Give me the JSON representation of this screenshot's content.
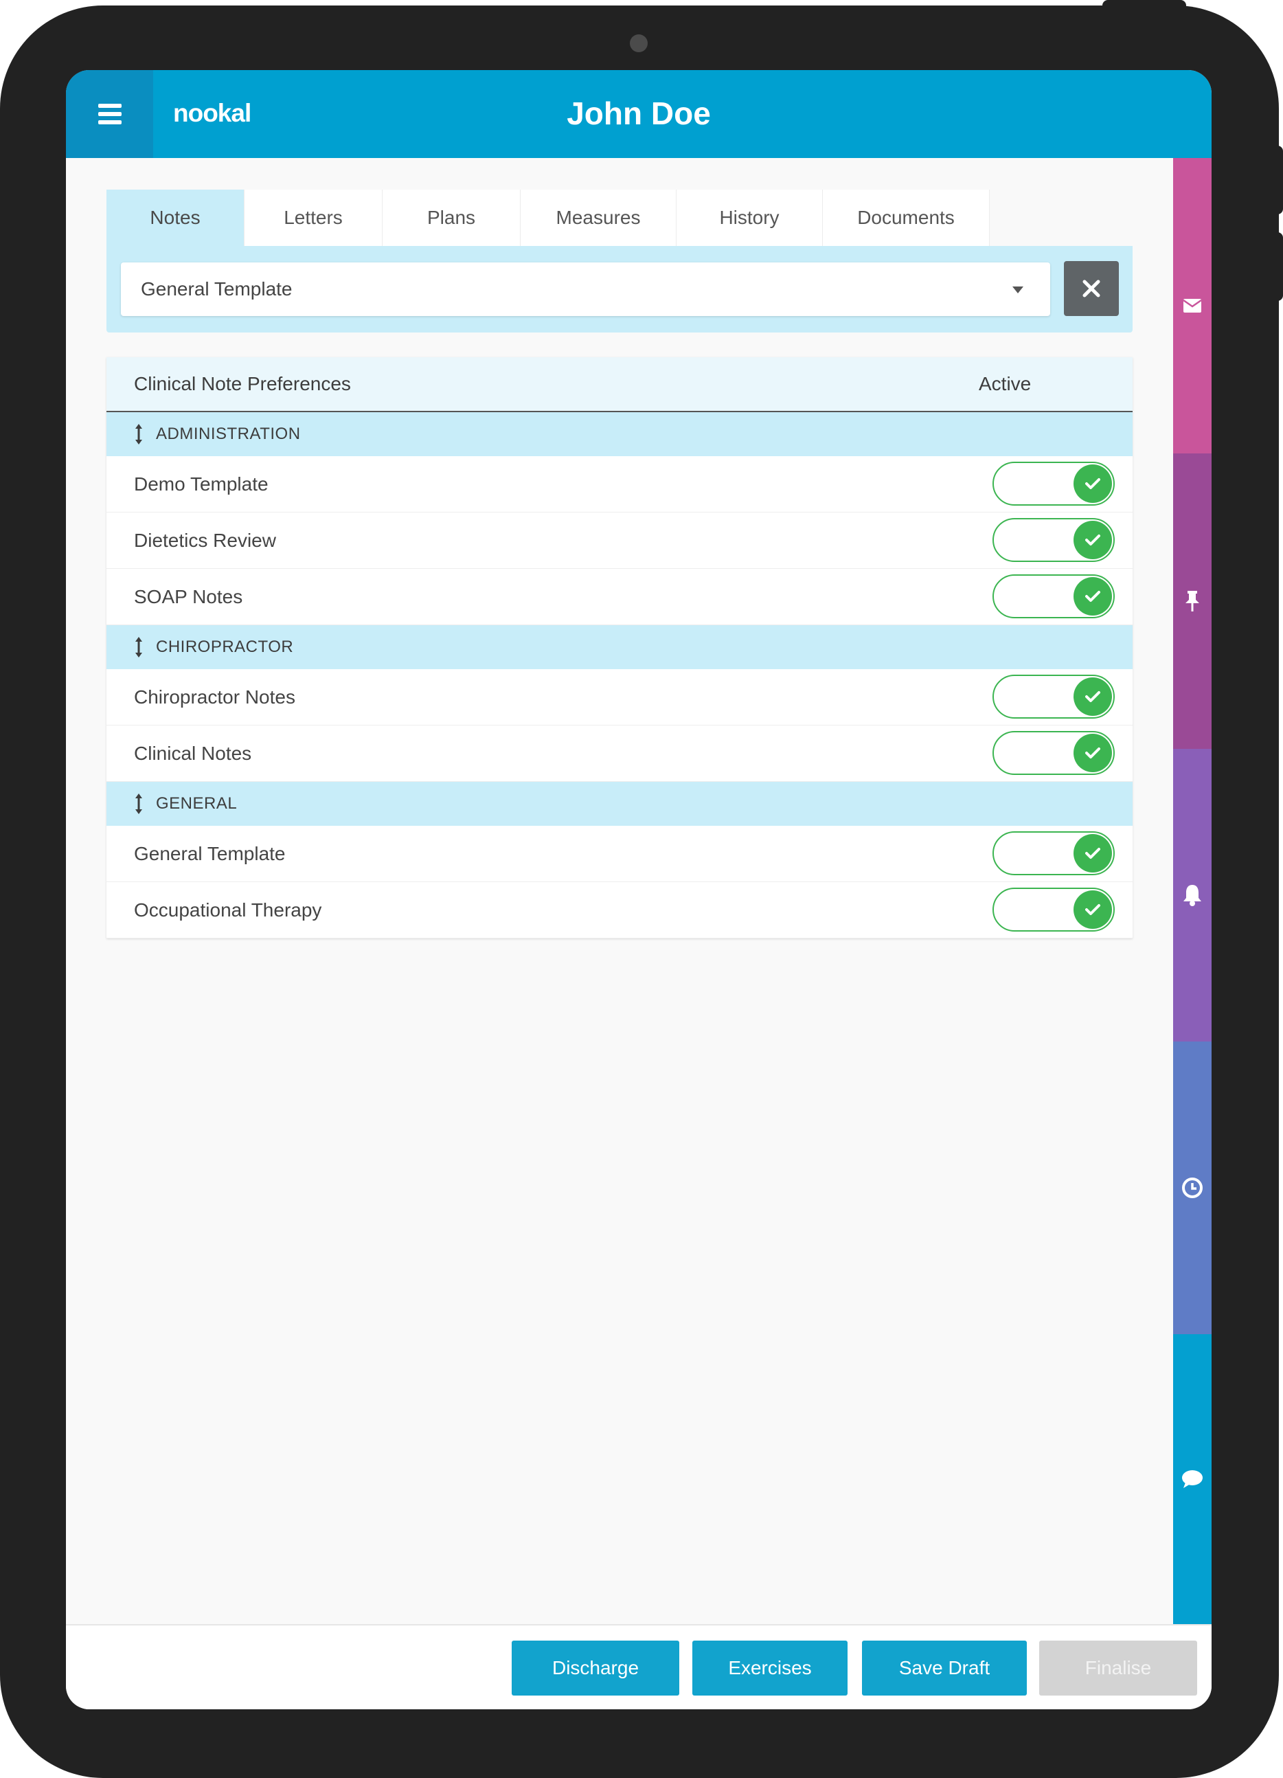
{
  "header": {
    "logo": "nookal",
    "patient_name": "John Doe"
  },
  "tabs": [
    {
      "label": "Notes",
      "active": true
    },
    {
      "label": "Letters"
    },
    {
      "label": "Plans"
    },
    {
      "label": "Measures"
    },
    {
      "label": "History"
    },
    {
      "label": "Documents"
    }
  ],
  "template_select": {
    "value": "General Template"
  },
  "table": {
    "header_left": "Clinical Note Preferences",
    "header_right": "Active",
    "groups": [
      {
        "label": "ADMINISTRATION",
        "rows": [
          {
            "label": "Demo Template",
            "active": true
          },
          {
            "label": "Dietetics Review",
            "active": true
          },
          {
            "label": "SOAP Notes",
            "active": true
          }
        ]
      },
      {
        "label": "CHIROPRACTOR",
        "rows": [
          {
            "label": "Chiropractor Notes",
            "active": true
          },
          {
            "label": "Clinical Notes",
            "active": true
          }
        ]
      },
      {
        "label": "GENERAL",
        "rows": [
          {
            "label": "General Template",
            "active": true
          },
          {
            "label": "Occupational Therapy",
            "active": true
          }
        ]
      }
    ]
  },
  "side_rail": [
    {
      "icon": "envelope-icon",
      "color": "#c9559b"
    },
    {
      "icon": "pin-icon",
      "color": "#9a4a96"
    },
    {
      "icon": "bell-icon",
      "color": "#8a5fb8"
    },
    {
      "icon": "clock-icon",
      "color": "#5f7cc6"
    },
    {
      "icon": "chat-icon",
      "color": "#04a0d0"
    }
  ],
  "footer": {
    "discharge": "Discharge",
    "exercises": "Exercises",
    "save_draft": "Save Draft",
    "finalise": "Finalise"
  },
  "colors": {
    "brand": "#00a0d0",
    "toggle_on": "#3cb551",
    "group_bg": "#c8edf9"
  }
}
